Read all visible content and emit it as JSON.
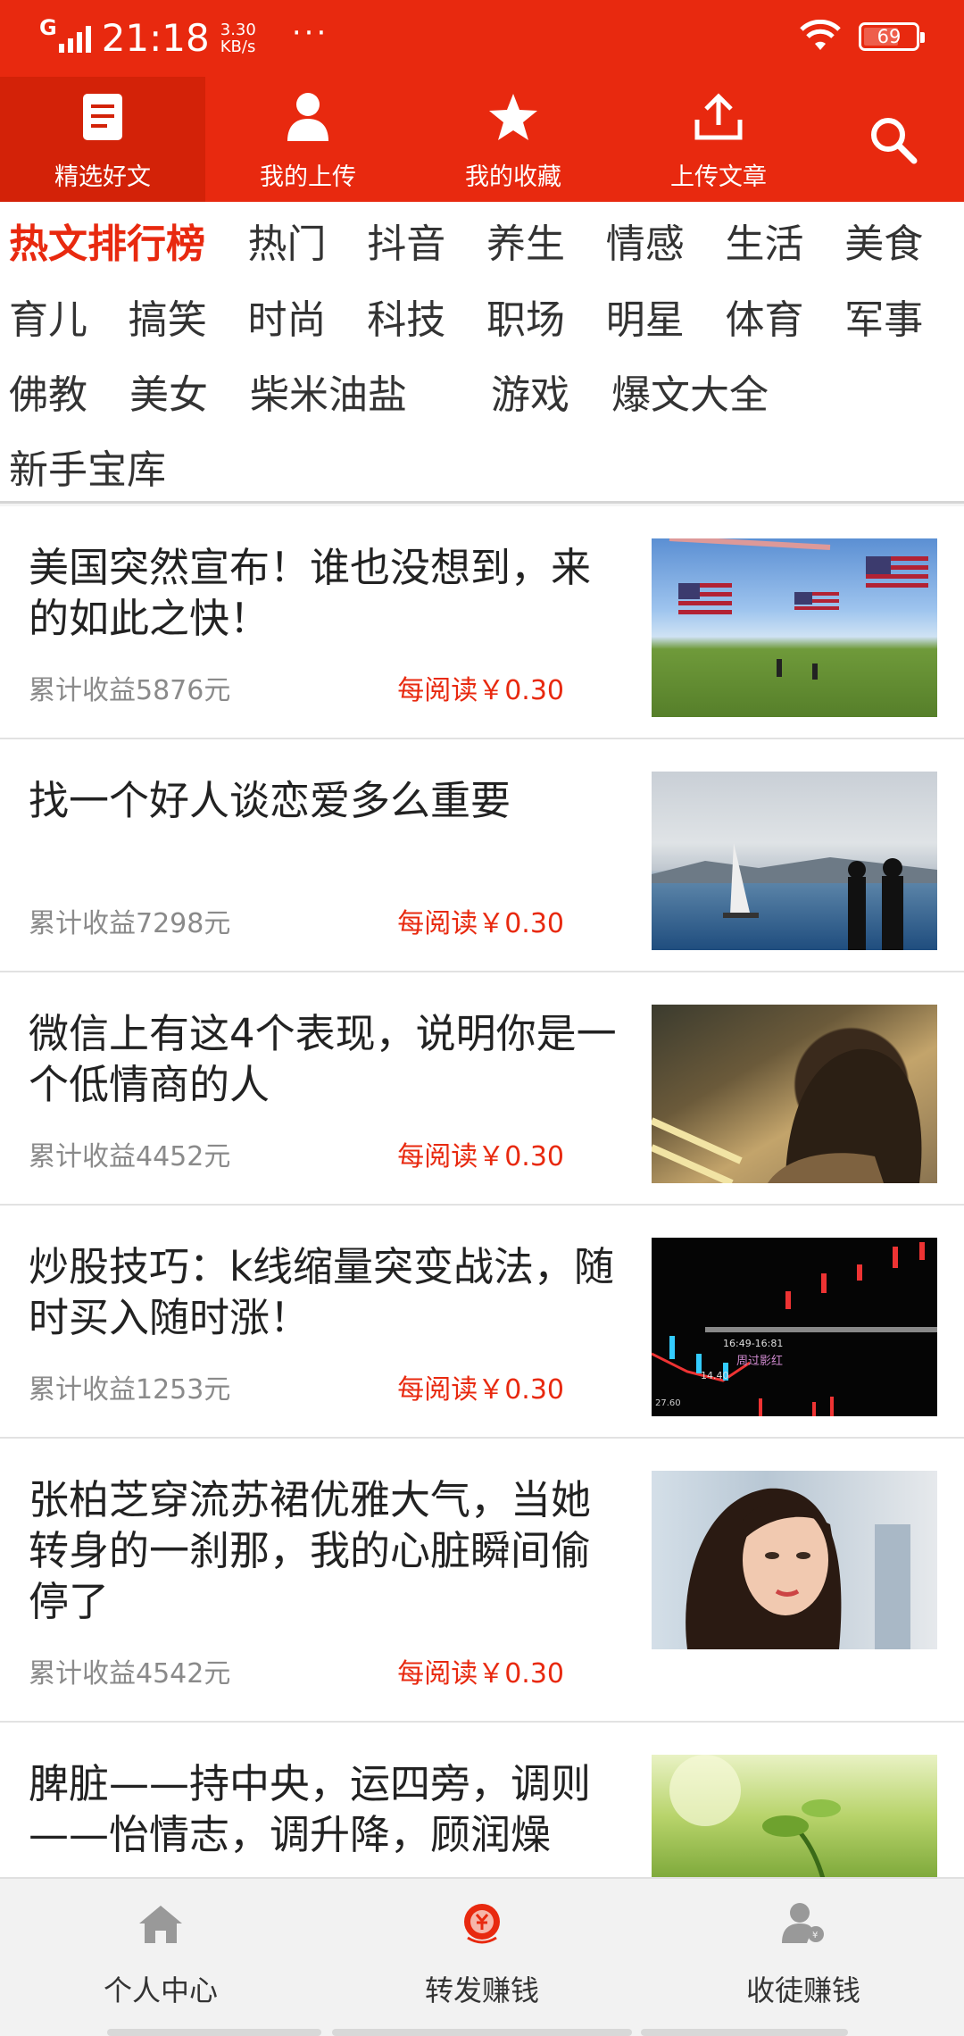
{
  "status_bar": {
    "network": "G",
    "time": "21:18",
    "speed_value": "3.30",
    "speed_unit": "KB/s",
    "more": "···",
    "battery": "69"
  },
  "topnav": {
    "items": [
      {
        "label": "精选好文",
        "icon": "document-icon"
      },
      {
        "label": "我的上传",
        "icon": "user-icon"
      },
      {
        "label": "我的收藏",
        "icon": "star-icon"
      },
      {
        "label": "上传文章",
        "icon": "upload-icon"
      }
    ],
    "search_icon": "search-icon"
  },
  "categories": {
    "rows": [
      [
        "热文排行榜",
        "热门",
        "抖音",
        "养生",
        "情感",
        "生活",
        "美食"
      ],
      [
        "育儿",
        "搞笑",
        "时尚",
        "科技",
        "职场",
        "明星",
        "体育",
        "军事"
      ],
      [
        "佛教",
        "美女",
        "柴米油盐",
        "游戏",
        "爆文大全"
      ],
      [
        "新手宝库"
      ]
    ]
  },
  "articles": [
    {
      "title": "美国突然宣布！谁也没想到，来的如此之快！",
      "income": "累计收益5876元",
      "price": "每阅读￥0.30",
      "thumb": "flags-photo"
    },
    {
      "title": "找一个好人谈恋爱多么重要",
      "income": "累计收益7298元",
      "price": "每阅读￥0.30",
      "thumb": "sea-couple-photo"
    },
    {
      "title": "微信上有这4个表现，说明你是一个低情商的人",
      "income": "累计收益4452元",
      "price": "每阅读￥0.30",
      "thumb": "girl-street-photo"
    },
    {
      "title": "炒股技巧：k线缩量突变战法，随时买入随时涨！",
      "income": "累计收益1253元",
      "price": "每阅读￥0.30",
      "thumb": "stock-chart-photo",
      "thumb_text": [
        "16:49-16:81",
        "周过影红",
        "14.40",
        "27.60"
      ]
    },
    {
      "title": "张柏芝穿流苏裙优雅大气，当她转身的一刹那，我的心脏瞬间偷停了",
      "income": "累计收益4542元",
      "price": "每阅读￥0.30",
      "thumb": "woman-portrait-photo"
    },
    {
      "title": "脾脏——持中央，运四旁，调则——怡情志，调升降，顾润燥",
      "income": "",
      "price": "",
      "thumb": "green-plant-photo"
    }
  ],
  "bottom_tabs": [
    {
      "label": "个人中心",
      "icon": "home-icon"
    },
    {
      "label": "转发赚钱",
      "icon": "yuan-coin-icon"
    },
    {
      "label": "收徒赚钱",
      "icon": "user-coin-icon"
    }
  ],
  "colors": {
    "brand_red": "#e8290f",
    "active_tab_red": "#d32208",
    "text_dark": "#222222",
    "text_gray": "#8a8a8a"
  }
}
